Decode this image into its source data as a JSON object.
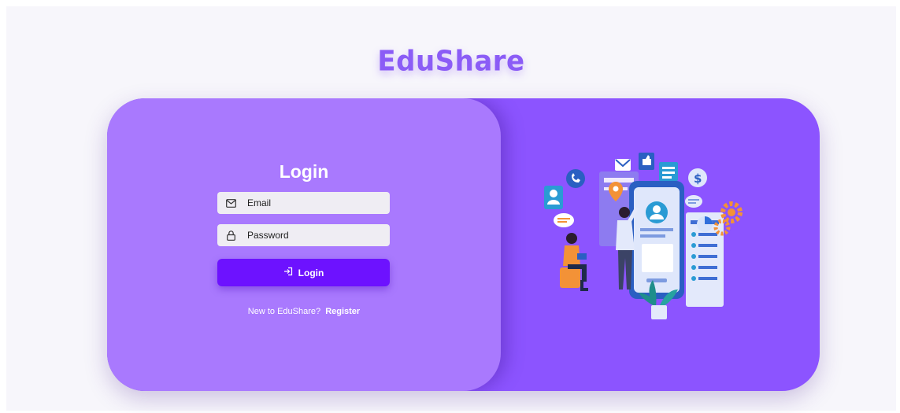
{
  "brand": {
    "name": "EduShare"
  },
  "form": {
    "title": "Login",
    "email_placeholder": "Email",
    "password_placeholder": "Password",
    "login_label": "Login",
    "register_prompt": "New to EduShare?",
    "register_label": "Register"
  },
  "icons": {
    "email": "envelope-icon",
    "password": "lock-icon",
    "login": "sign-in-icon"
  },
  "colors": {
    "background": "#f7f6fb",
    "card": "#8c54ff",
    "form_panel": "#a979fe",
    "button": "#6d12ff",
    "brand": "#8b5cf6"
  }
}
